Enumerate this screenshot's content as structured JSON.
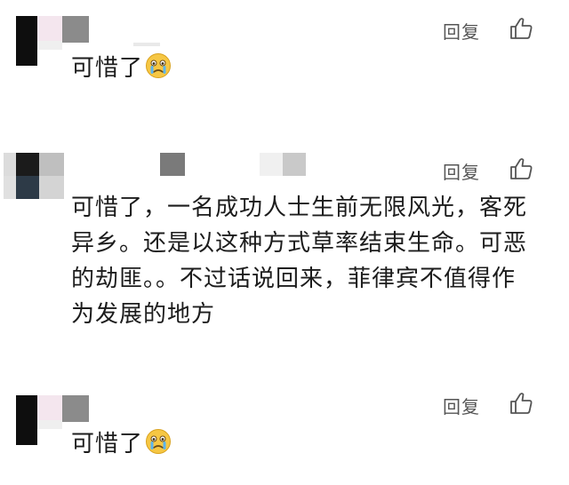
{
  "comments": [
    {
      "text": "可惜了",
      "reply_label": "回复",
      "like_icon": "thumbs-up-icon",
      "emoji_icon": "crying-face-icon"
    },
    {
      "text": "可惜了，一名成功人士生前无限风光，客死异乡。还是以这种方式草率结束生命。可恶的劫匪。。不过话说回来，菲律宾不值得作为发展的地方",
      "reply_label": "回复",
      "like_icon": "thumbs-up-icon"
    },
    {
      "text": "可惜了",
      "reply_label": "回复",
      "like_icon": "thumbs-up-icon",
      "emoji_icon": "crying-face-icon"
    }
  ],
  "colors": {
    "text": "#1c1c1c",
    "reply": "#555555",
    "background": "#ffffff"
  }
}
